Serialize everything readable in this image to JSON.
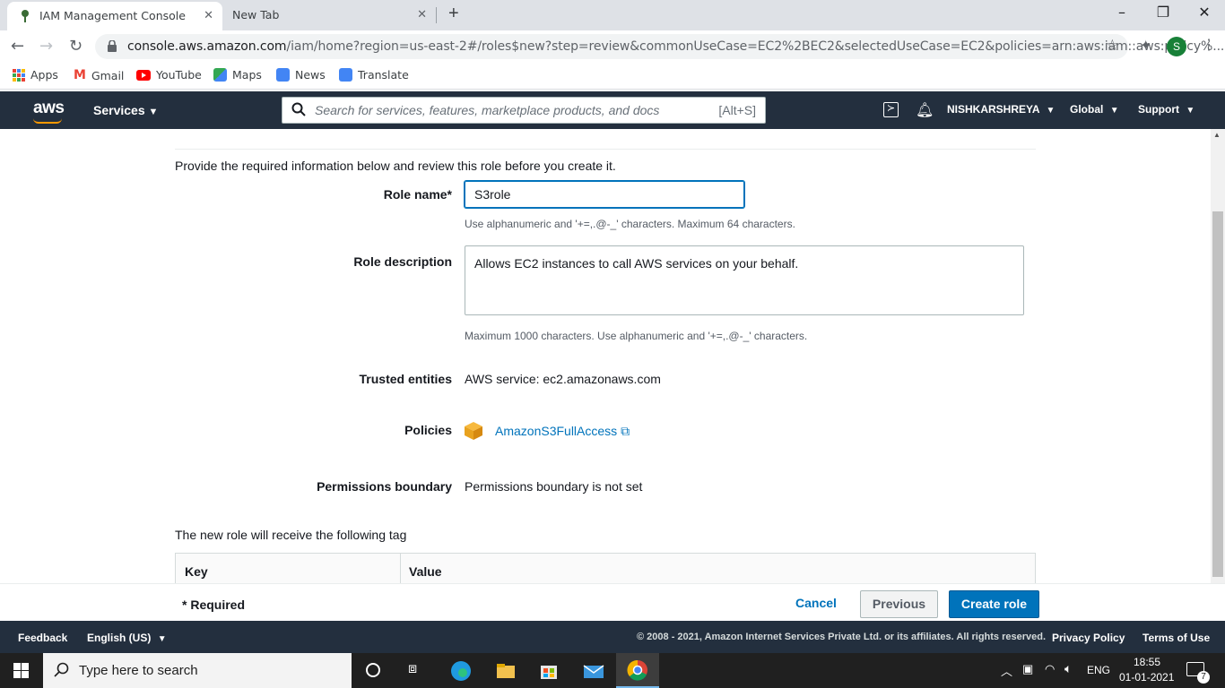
{
  "browser": {
    "tabs": [
      {
        "title": "IAM Management Console",
        "active": true
      },
      {
        "title": "New Tab",
        "active": false
      }
    ],
    "url_host": "console.aws.amazon.com",
    "url_path": "/iam/home?region=us-east-2#/roles$new?step=review&commonUseCase=EC2%2BEC2&selectedUseCase=EC2&policies=arn:aws:iam::aws:policy%...",
    "profile_initial": "S",
    "bookmarks": [
      "Apps",
      "Gmail",
      "YouTube",
      "Maps",
      "News",
      "Translate"
    ]
  },
  "aws_nav": {
    "logo": "aws",
    "services": "Services",
    "search_placeholder": "Search for services, features, marketplace products, and docs",
    "search_shortcut": "[Alt+S]",
    "account": "NISHKARSHREYA",
    "region": "Global",
    "support": "Support"
  },
  "form": {
    "intro": "Provide the required information below and review this role before you create it.",
    "role_name_label": "Role name*",
    "role_name_value": "S3role",
    "role_name_hint": "Use alphanumeric and '+=,.@-_' characters. Maximum 64 characters.",
    "role_desc_label": "Role description",
    "role_desc_value": "Allows EC2 instances to call AWS services on your behalf.",
    "role_desc_hint": "Maximum 1000 characters. Use alphanumeric and '+=,.@-_' characters.",
    "trusted_label": "Trusted entities",
    "trusted_value": "AWS service: ec2.amazonaws.com",
    "policies_label": "Policies",
    "policy_link": "AmazonS3FullAccess",
    "boundary_label": "Permissions boundary",
    "boundary_value": "Permissions boundary is not set",
    "tag_intro": "The new role will receive the following tag",
    "tag_columns": [
      "Key",
      "Value"
    ]
  },
  "actions": {
    "required": "* Required",
    "cancel": "Cancel",
    "previous": "Previous",
    "create": "Create role"
  },
  "console_footer": {
    "feedback": "Feedback",
    "language": "English (US)",
    "copyright": "© 2008 - 2021, Amazon Internet Services Private Ltd. or its affiliates. All rights reserved.",
    "privacy": "Privacy Policy",
    "terms": "Terms of Use"
  },
  "taskbar": {
    "search_placeholder": "Type here to search",
    "lang": "ENG",
    "time": "18:55",
    "date": "01-01-2021",
    "notifications": "7"
  },
  "colors": {
    "aws_nav": "#232f3e",
    "primary_button": "#0073bb",
    "aws_orange": "#ff9900"
  }
}
